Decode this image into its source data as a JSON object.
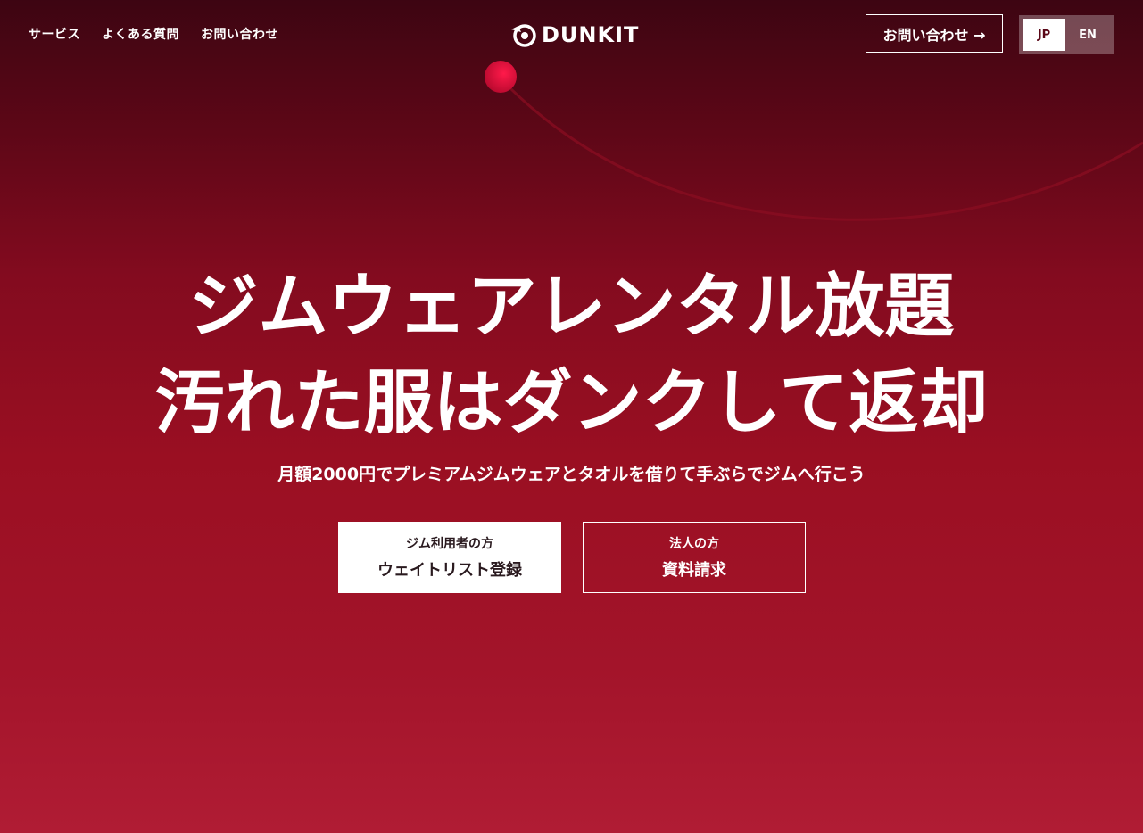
{
  "header": {
    "nav": [
      {
        "label": "サービス"
      },
      {
        "label": "よくある質問"
      },
      {
        "label": "お問い合わせ"
      }
    ],
    "logo_text": "DUNKIT",
    "contact_button": "お問い合わせ →",
    "language": {
      "options": [
        "JP",
        "EN"
      ],
      "selected": "JP"
    }
  },
  "hero": {
    "title_line1": "ジムウェアレンタル放題",
    "title_line2": "汚れた服はダンクして返却",
    "subtitle": "月額2000円でプレミアムジムウェアとタオルを借りて手ぶらでジムへ行こう",
    "buttons": [
      {
        "small": "ジム利用者の方",
        "big": "ウェイトリスト登録"
      },
      {
        "small": "法人の方",
        "big": "資料請求"
      }
    ]
  },
  "colors": {
    "bg_top": "#3d0512",
    "bg_bottom": "#b01c34",
    "accent_ball": "#e0103a"
  }
}
